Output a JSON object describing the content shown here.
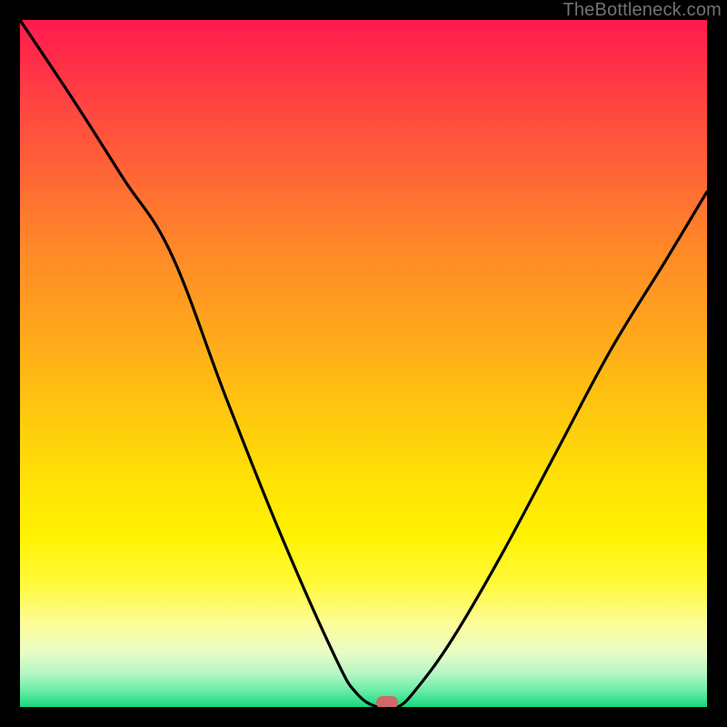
{
  "watermark": "TheBottleneck.com",
  "colors": {
    "frame": "#000000",
    "curve": "#000000",
    "marker": "#d06868",
    "watermark": "#727272"
  },
  "chart_data": {
    "type": "line",
    "title": "",
    "xlabel": "",
    "ylabel": "",
    "xlim": [
      0,
      100
    ],
    "ylim": [
      0,
      100
    ],
    "series": [
      {
        "name": "bottleneck-curve",
        "x": [
          0,
          8,
          15,
          22,
          30,
          38,
          46,
          49,
          52,
          55,
          58,
          63,
          70,
          78,
          86,
          94,
          100
        ],
        "y": [
          100,
          88,
          77,
          66,
          45,
          25,
          7,
          2,
          0,
          0,
          3,
          10,
          22,
          37,
          52,
          65,
          75
        ]
      }
    ],
    "marker": {
      "x": 53.5,
      "y": 0.6
    },
    "gradient_stops": [
      {
        "pos": 0,
        "color": "#ff1a4d"
      },
      {
        "pos": 50,
        "color": "#ffb914"
      },
      {
        "pos": 80,
        "color": "#fff93a"
      },
      {
        "pos": 100,
        "color": "#17d87d"
      }
    ]
  }
}
